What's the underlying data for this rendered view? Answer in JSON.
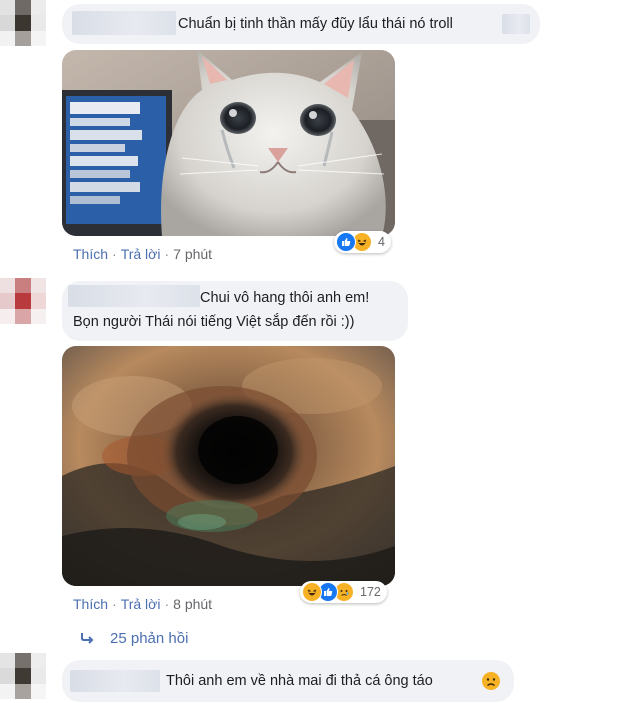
{
  "comments": [
    {
      "text": "Chuẩn bị tinh thần mấy đũy lẩu thái nó troll",
      "image_icon": "crying-cat-photo",
      "meta": {
        "like": "Thích",
        "reply": "Trả lời",
        "time": "7 phút"
      },
      "reactions": {
        "icons": [
          "like-icon",
          "haha-icon"
        ],
        "count": "4"
      }
    },
    {
      "text_lines": [
        "Chui vô hang thôi anh em!",
        "Bọn người Thái nói tiếng Việt sắp đến rồi :))"
      ],
      "image_icon": "cave-hole-photo",
      "meta": {
        "like": "Thích",
        "reply": "Trả lời",
        "time": "8 phút"
      },
      "reactions": {
        "icons": [
          "haha-icon",
          "like-icon",
          "sad-icon"
        ],
        "count": "172"
      },
      "replies_label": "25 phản hồi"
    },
    {
      "text": "Thôi anh em về nhà mai đi thả cá ông táo",
      "emoji_icon": "sad-face-icon"
    }
  ],
  "colors": {
    "bubble": "#f0f2f5",
    "link": "#4b6fb0",
    "meta": "#65676b",
    "like": "#1877f2",
    "haha": "#f7b125"
  }
}
